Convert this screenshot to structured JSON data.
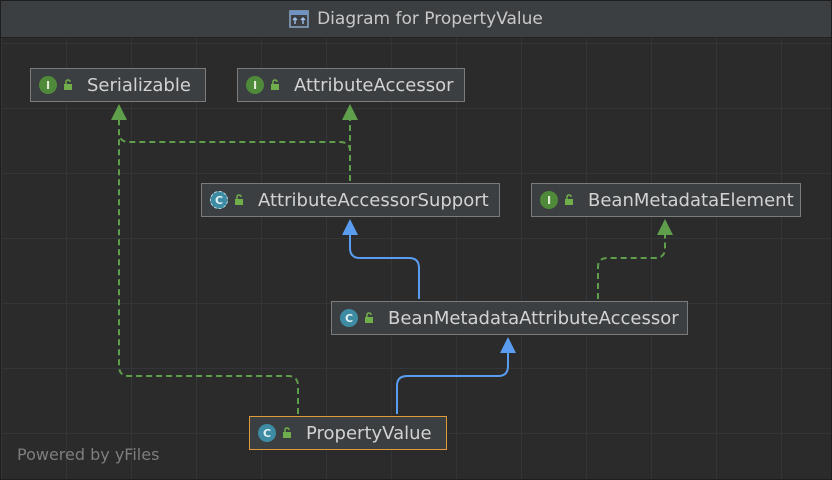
{
  "window": {
    "title": "Diagram for PropertyValue"
  },
  "nodes": {
    "serializable": {
      "label": "Serializable",
      "kind": "interface",
      "badge": "I"
    },
    "attributeAccessor": {
      "label": "AttributeAccessor",
      "kind": "interface",
      "badge": "I"
    },
    "attributeAccessorSupport": {
      "label": "AttributeAccessorSupport",
      "kind": "abstract-class",
      "badge": "C"
    },
    "beanMetadataElement": {
      "label": "BeanMetadataElement",
      "kind": "interface",
      "badge": "I"
    },
    "beanMetadataAttributeAccessor": {
      "label": "BeanMetadataAttributeAccessor",
      "kind": "class",
      "badge": "C"
    },
    "propertyValue": {
      "label": "PropertyValue",
      "kind": "class",
      "badge": "C",
      "selected": true
    }
  },
  "edges": [
    {
      "from": "attributeAccessorSupport",
      "to": "serializable",
      "type": "implements"
    },
    {
      "from": "attributeAccessorSupport",
      "to": "attributeAccessor",
      "type": "implements"
    },
    {
      "from": "beanMetadataAttributeAccessor",
      "to": "attributeAccessorSupport",
      "type": "extends"
    },
    {
      "from": "beanMetadataAttributeAccessor",
      "to": "beanMetadataElement",
      "type": "implements"
    },
    {
      "from": "propertyValue",
      "to": "beanMetadataAttributeAccessor",
      "type": "extends"
    },
    {
      "from": "propertyValue",
      "to": "serializable",
      "type": "implements"
    }
  ],
  "colors": {
    "implements": "#5f9e4a",
    "extends": "#5a9cf0",
    "selected_border": "#e09a3a"
  },
  "footer": "Powered by yFiles",
  "icons": {
    "title": "class-diagram-icon",
    "lock": "unlocked-padlock-icon"
  }
}
